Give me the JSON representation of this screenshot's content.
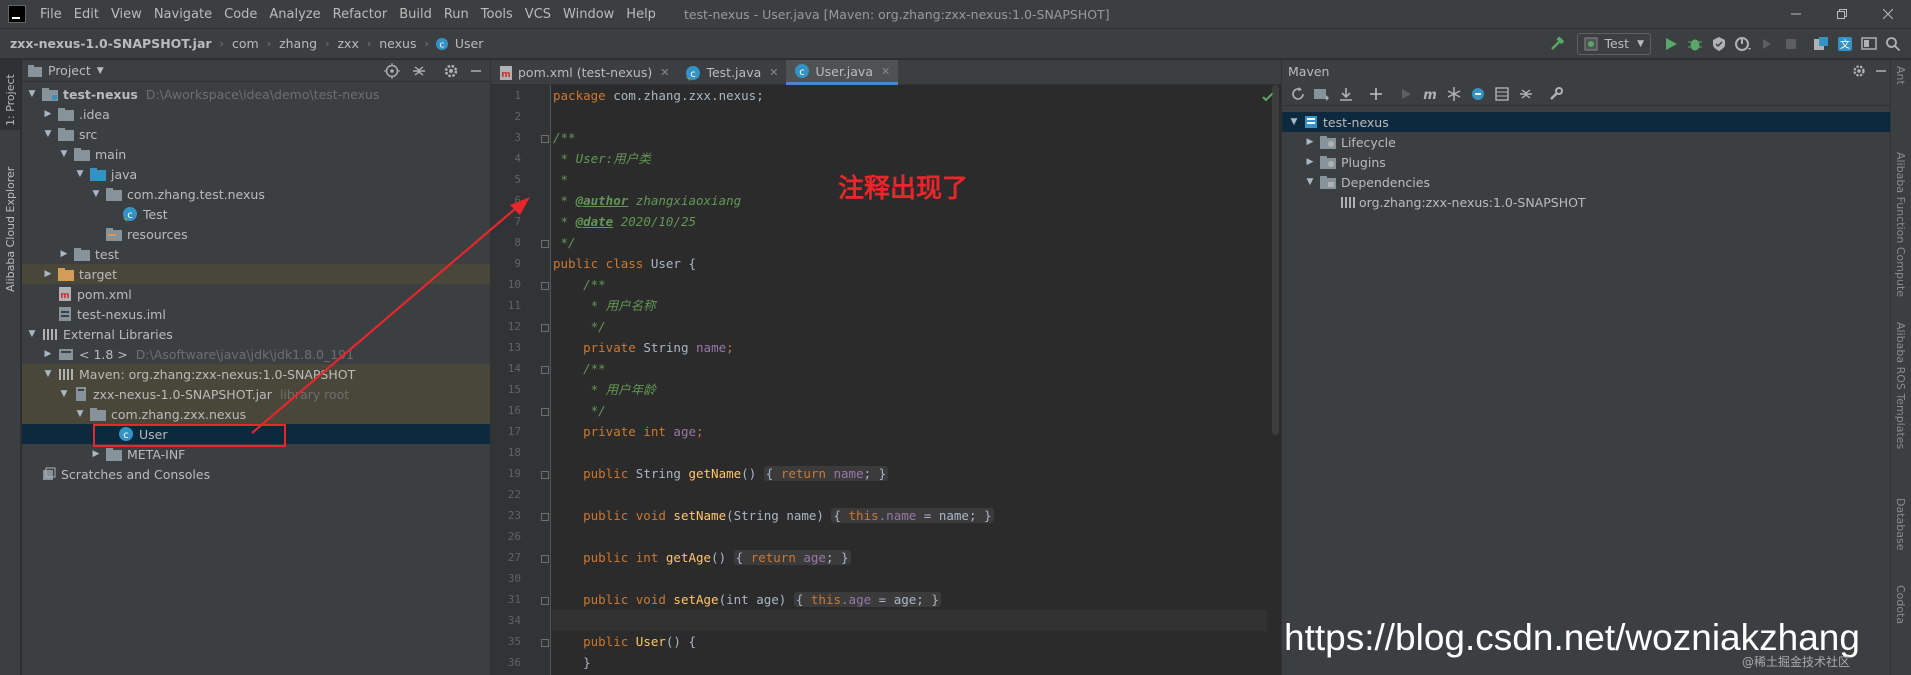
{
  "menubar": {
    "items": [
      "File",
      "Edit",
      "View",
      "Navigate",
      "Code",
      "Analyze",
      "Refactor",
      "Build",
      "Run",
      "Tools",
      "VCS",
      "Window",
      "Help"
    ],
    "window_title": "test-nexus - User.java [Maven: org.zhang:zxx-nexus:1.0-SNAPSHOT]"
  },
  "navbar": {
    "breadcrumbs": [
      "zxx-nexus-1.0-SNAPSHOT.jar",
      "com",
      "zhang",
      "zxx",
      "nexus",
      "User"
    ],
    "run_config": "Test"
  },
  "left_stripe": {
    "project_tab": "1: Project",
    "cloud_tab": "Alibaba Cloud Explorer"
  },
  "right_stripe": {
    "tabs": [
      "Ant",
      "Alibaba Function Compute",
      "Alibaba ROS Templates",
      "Database",
      "Codota"
    ]
  },
  "project": {
    "title": "Project",
    "tree": [
      {
        "label": "test-nexus",
        "path": "D:\\Aworkspace\\idea\\demo\\test-nexus",
        "bold": true
      },
      {
        "label": ".idea"
      },
      {
        "label": "src"
      },
      {
        "label": "main"
      },
      {
        "label": "java"
      },
      {
        "label": "com.zhang.test.nexus"
      },
      {
        "label": "Test"
      },
      {
        "label": "resources"
      },
      {
        "label": "test"
      },
      {
        "label": "target"
      },
      {
        "label": "pom.xml"
      },
      {
        "label": "test-nexus.iml"
      },
      {
        "label": "External Libraries"
      },
      {
        "label": "< 1.8 >",
        "path": "D:\\Asoftware\\java\\jdk\\jdk1.8.0_191"
      },
      {
        "label": "Maven: org.zhang:zxx-nexus:1.0-SNAPSHOT"
      },
      {
        "label": "zxx-nexus-1.0-SNAPSHOT.jar",
        "path": "library root"
      },
      {
        "label": "com.zhang.zxx.nexus"
      },
      {
        "label": "User"
      },
      {
        "label": "META-INF"
      },
      {
        "label": "Scratches and Consoles"
      }
    ]
  },
  "editor": {
    "tabs": [
      "pom.xml (test-nexus)",
      "Test.java",
      "User.java"
    ],
    "line_numbers": [
      "1",
      "2",
      "3",
      "4",
      "5",
      "6",
      "7",
      "8",
      "9",
      "10",
      "11",
      "12",
      "13",
      "14",
      "15",
      "16",
      "17",
      "18",
      "19",
      "22",
      "23",
      "26",
      "27",
      "30",
      "31",
      "34",
      "35",
      "36"
    ],
    "code": {
      "l1_kw": "package",
      "l1_rest": " com.zhang.zxx.nexus;",
      "l3": "/**",
      "l4": " * User:用户类",
      "l5": " *",
      "l6_pre": " * ",
      "l6_tag": "@author",
      "l6_rest": " zhangxiaoxiang",
      "l7_pre": " * ",
      "l7_tag": "@date",
      "l7_rest": " 2020/10/25",
      "l8": " */",
      "l9_kw": "public class",
      "l9_rest": " User {",
      "l10": "    /**",
      "l11": "     * 用户名称",
      "l12": "     */",
      "l13_kw": "    private",
      "l13_type": " String ",
      "l13_fld": "name",
      "l13_end": ";",
      "l14": "    /**",
      "l15": "     * 用户年龄",
      "l16": "     */",
      "l17_kw": "    private int",
      "l17_sp": " ",
      "l17_fld": "age",
      "l17_end": ";",
      "l19_kw": "    public",
      "l19_type": " String ",
      "l19_fn": "getName",
      "l19_args": "() ",
      "l19_body_kw": "return",
      "l19_body_fld": " name",
      "l19_body_end": "; }",
      "l23_kw": "    public void",
      "l23_sp": " ",
      "l23_fn": "setName",
      "l23_args": "(String name) ",
      "l23_body_kw": "this",
      "l23_body_fld": ".name",
      "l23_body_end": " = name; }",
      "l27_kw": "    public int",
      "l27_sp": " ",
      "l27_fn": "getAge",
      "l27_args": "() ",
      "l27_body_kw": "return",
      "l27_body_fld": " age",
      "l27_body_end": "; }",
      "l31_kw": "    public void",
      "l31_sp": " ",
      "l31_fn": "setAge",
      "l31_args": "(int age) ",
      "l31_body_kw": "this",
      "l31_body_fld": ".age",
      "l31_body_end": " = age; }",
      "l35_kw": "    public",
      "l35_sp": " ",
      "l35_fn": "User",
      "l35_args": "() {",
      "l36": "    }"
    }
  },
  "maven": {
    "title": "Maven",
    "tree": [
      "test-nexus",
      "Lifecycle",
      "Plugins",
      "Dependencies",
      "org.zhang:zxx-nexus:1.0-SNAPSHOT"
    ]
  },
  "annotation": {
    "text": "注释出现了",
    "color": "#e8262b"
  },
  "watermark": {
    "url": "https://blog.csdn.net/wozniakzhang",
    "credit": "@稀土掘金技术社区"
  },
  "colors": {
    "keyword": "#cc7832",
    "comment": "#629755",
    "function": "#ffc66d",
    "field": "#9876aa",
    "selection": "#0d293e"
  }
}
